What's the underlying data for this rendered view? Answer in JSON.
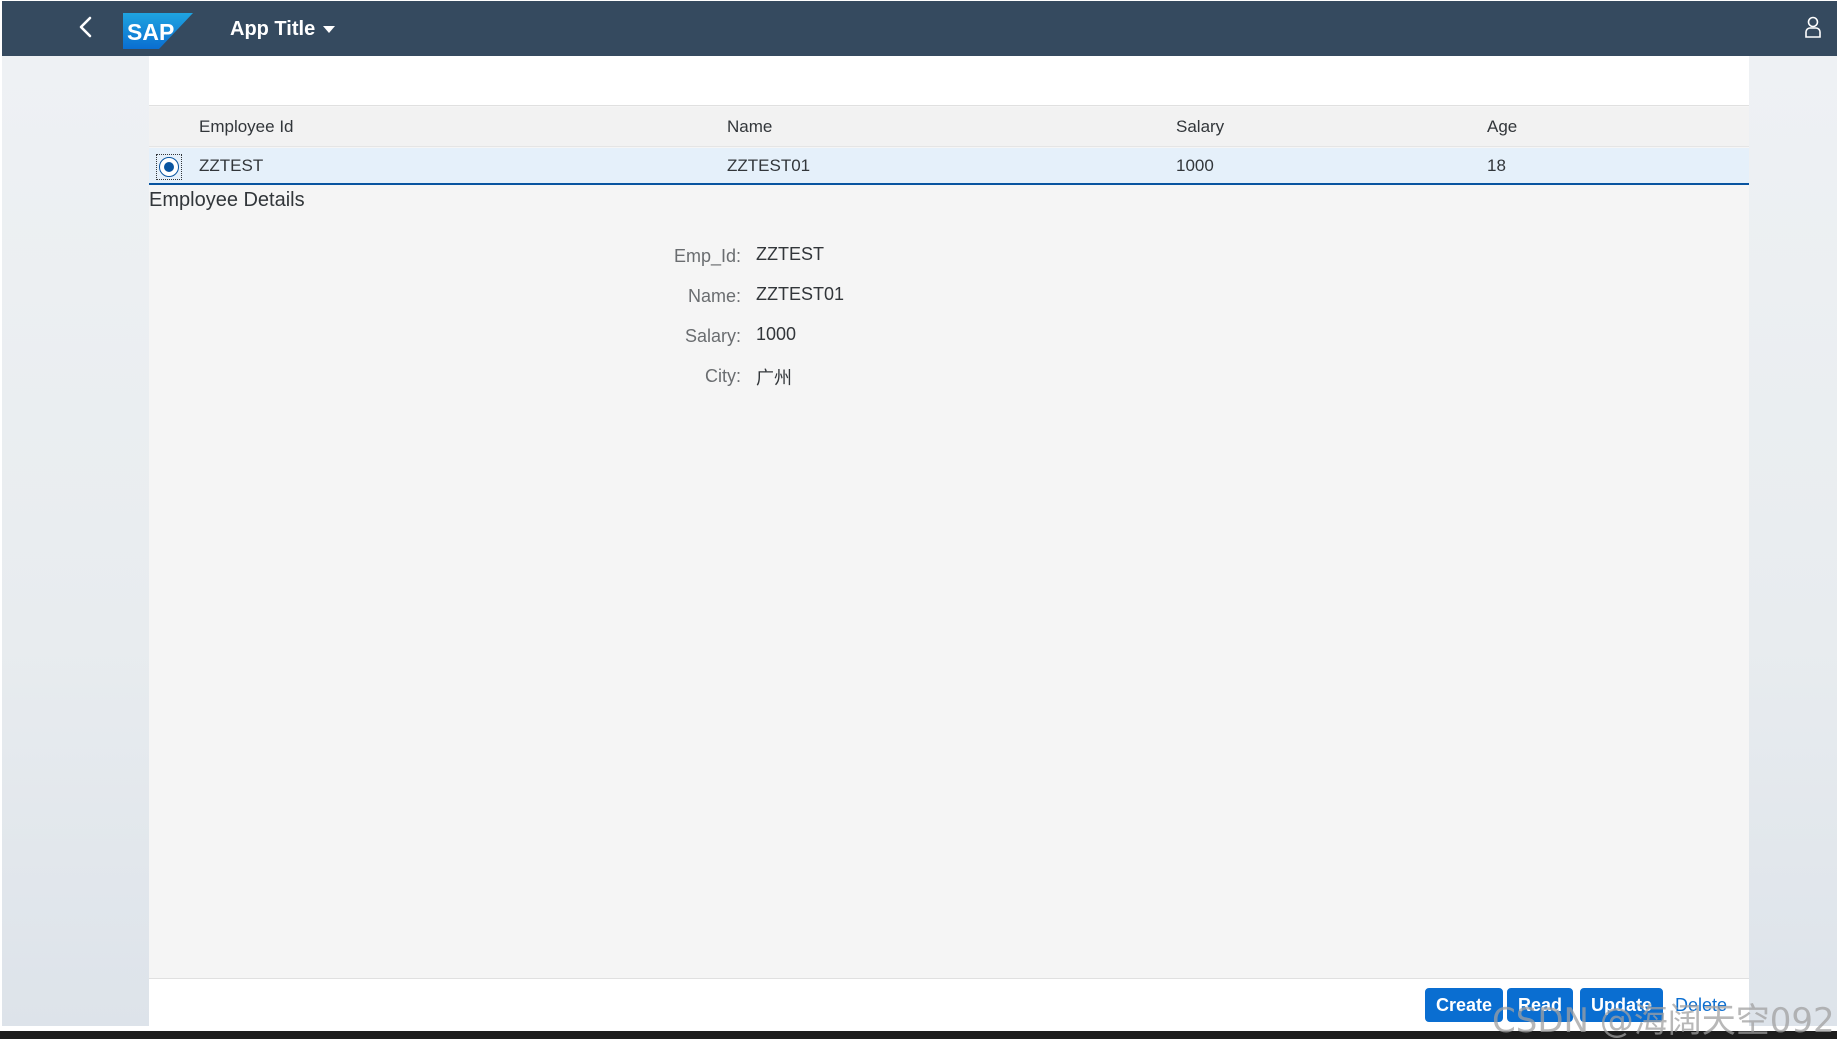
{
  "colors": {
    "shell": "#354a5f",
    "accent": "#0a6ed1",
    "selected_row": "#e5f0fa",
    "page_bg": "#f5f5f5"
  },
  "shell": {
    "back_icon": "chevron-left-icon",
    "logo_text": "SAP",
    "app_title": "App Title",
    "user_icon": "user-icon"
  },
  "table": {
    "columns": [
      "Employee Id",
      "Name",
      "Salary",
      "Age"
    ],
    "rows": [
      {
        "selected": true,
        "employee_id": "ZZTEST",
        "name": "ZZTEST01",
        "salary": "1000",
        "age": "18"
      }
    ]
  },
  "details": {
    "title": "Employee Details",
    "fields": [
      {
        "label": "Emp_Id:",
        "value": "ZZTEST"
      },
      {
        "label": "Name:",
        "value": "ZZTEST01"
      },
      {
        "label": "Salary:",
        "value": "1000"
      },
      {
        "label": "City:",
        "value": "广州"
      }
    ]
  },
  "footer": {
    "create": "Create",
    "read": "Read",
    "update": "Update",
    "delete": "Delete"
  },
  "watermark": "CSDN @海阔天空092"
}
